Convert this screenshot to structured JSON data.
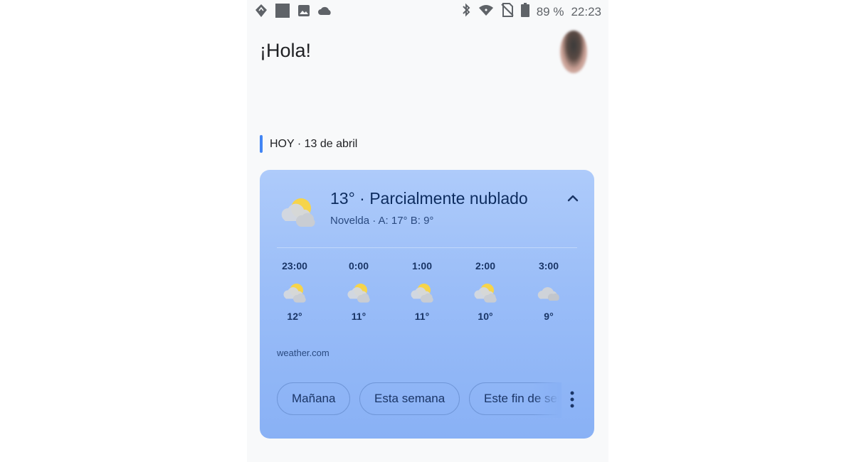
{
  "status_bar": {
    "left_icons": [
      "navigation-icon",
      "square-app-icon",
      "image-icon",
      "cloud-icon"
    ],
    "right_icons": [
      "bluetooth-icon",
      "wifi-icon",
      "no-sim-icon",
      "battery-icon"
    ],
    "battery": "89 %",
    "time": "22:23"
  },
  "header": {
    "greeting": "¡Hola!"
  },
  "section": {
    "date_label": "HOY · 13 de abril"
  },
  "weather": {
    "title": "13° · Parcialmente nublado",
    "subtitle": "Novelda · A: 17° B: 9°",
    "current_icon": "partly-cloudy-icon",
    "hourly": [
      {
        "time": "23:00",
        "temp": "12°",
        "icon": "partly-cloudy-icon"
      },
      {
        "time": "0:00",
        "temp": "11°",
        "icon": "partly-cloudy-icon"
      },
      {
        "time": "1:00",
        "temp": "11°",
        "icon": "partly-cloudy-icon"
      },
      {
        "time": "2:00",
        "temp": "10°",
        "icon": "partly-cloudy-icon"
      },
      {
        "time": "3:00",
        "temp": "9°",
        "icon": "cloudy-icon"
      }
    ],
    "source": "weather.com",
    "chips": [
      "Mañana",
      "Esta semana",
      "Este fin de semana"
    ]
  },
  "colors": {
    "accent": "#4285f4",
    "card_top": "#aecbfa",
    "card_bottom": "#89b1f5",
    "title_text": "#0d2c5f",
    "sun": "#f6d44a",
    "cloud": "#d0d4da"
  }
}
